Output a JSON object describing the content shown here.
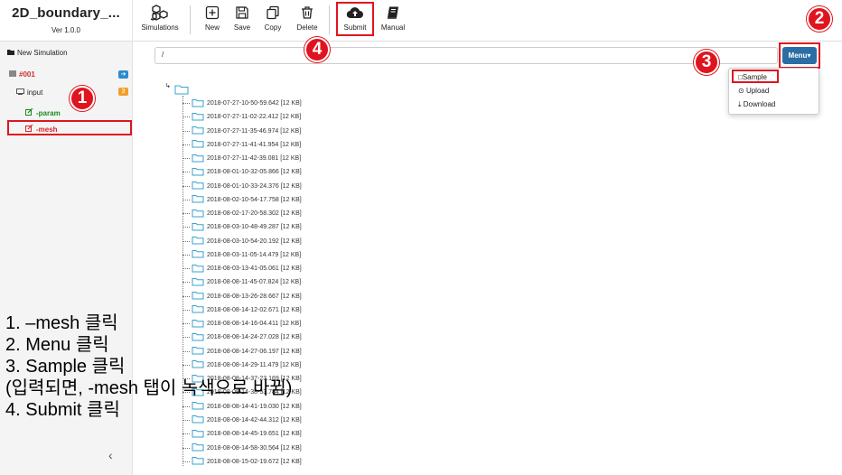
{
  "app": {
    "title": "2D_boundary_...",
    "version": "Ver 1.0.0"
  },
  "toolbar": [
    {
      "id": "simulations",
      "label": "Simulations",
      "icon": "cubes-icon"
    },
    {
      "id": "new",
      "label": "New",
      "icon": "plus-square-icon"
    },
    {
      "id": "save",
      "label": "Save",
      "icon": "floppy-disk-icon"
    },
    {
      "id": "copy",
      "label": "Copy",
      "icon": "copy-icon"
    },
    {
      "id": "delete",
      "label": "Delete",
      "icon": "trash-icon"
    },
    {
      "id": "submit",
      "label": "Submit",
      "icon": "cloud-upload-icon"
    },
    {
      "id": "manual",
      "label": "Manual",
      "icon": "book-icon"
    }
  ],
  "sidebar": {
    "new_simulation": "New Simulation",
    "sim_id": "#001",
    "input_label": "input",
    "input_badge": "3",
    "param_label": "-param",
    "mesh_label": "-mesh"
  },
  "path": {
    "value": "/"
  },
  "menu": {
    "button_label": "Menu",
    "items": [
      {
        "label": "Sample",
        "icon": "file-icon"
      },
      {
        "label": "Upload",
        "icon": "upload-icon"
      },
      {
        "label": "Download",
        "icon": "download-icon"
      }
    ]
  },
  "files": [
    "2018-07-27-10-50-59.642 [12 KB]",
    "2018-07-27-11-02-22.412 [12 KB]",
    "2018-07-27-11-35-46.974 [12 KB]",
    "2018-07-27-11-41-41.954 [12 KB]",
    "2018-07-27-11-42-39.081 [12 KB]",
    "2018-08-01-10-32-05.866 [12 KB]",
    "2018-08-01-10-33-24.376 [12 KB]",
    "2018-08-02-10-54-17.758 [12 KB]",
    "2018-08-02-17-20-58.302 [12 KB]",
    "2018-08-03-10-48-49.287 [12 KB]",
    "2018-08-03-10-54-20.192 [12 KB]",
    "2018-08-03-11-05-14.479 [12 KB]",
    "2018-08-03-13-41-05.061 [12 KB]",
    "2018-08-08-11-45-07.824 [12 KB]",
    "2018-08-08-13-26-28.667 [12 KB]",
    "2018-08-08-14-12-02.671 [12 KB]",
    "2018-08-08-14-16-04.411 [12 KB]",
    "2018-08-08-14-24-27.028 [12 KB]",
    "2018-08-08-14-27-06.197 [12 KB]",
    "2018-08-08-14-29-11.479 [12 KB]",
    "2018-08-08-14-37-23.169 [12 KB]",
    "2018-08-08-14-38-53.784 [12 KB]",
    "2018-08-08-14-41-19.030 [12 KB]",
    "2018-08-08-14-42-44.312 [12 KB]",
    "2018-08-08-14-45-19.651 [12 KB]",
    "2018-08-08-14-58-30.564 [12 KB]",
    "2018-08-08-15-02-19.672 [12 KB]"
  ],
  "annotations": {
    "markers": [
      "1",
      "2",
      "3",
      "4"
    ],
    "instructions": [
      "1. –mesh 클릭",
      "2. Menu 클릭",
      "3. Sample 클릭",
      "(입력되면, -mesh 탭이 녹색으로 바뀜)",
      "4. Submit 클릭"
    ]
  },
  "colors": {
    "accent": "#2b6ea5",
    "annotation": "#e0141e",
    "param_green": "#1a8a1a",
    "mesh_red": "#d9232b",
    "sim_red": "#c9302c",
    "badge_blue": "#2d8ccd",
    "badge_orange": "#f0a02a"
  }
}
